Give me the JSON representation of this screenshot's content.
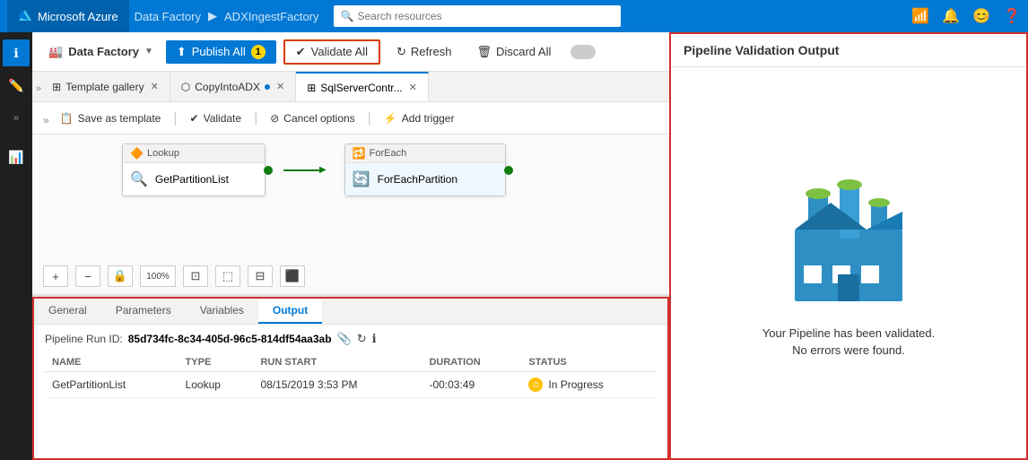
{
  "topbar": {
    "brand": "Microsoft Azure",
    "breadcrumb": [
      "Data Factory",
      "ADXIngestFactory"
    ],
    "search_placeholder": "Search resources",
    "icons": [
      "wifi-icon",
      "bell-icon",
      "face-icon",
      "question-icon"
    ]
  },
  "toolbar1": {
    "df_label": "Data Factory",
    "publish_label": "Publish All",
    "publish_badge": "1",
    "validate_all_label": "Validate All",
    "refresh_label": "Refresh",
    "discard_label": "Discard All"
  },
  "tabs": [
    {
      "label": "Template gallery",
      "icon": "template-icon",
      "closable": true,
      "active": false
    },
    {
      "label": "CopyIntoADX",
      "icon": "copy-icon",
      "closable": true,
      "active": false,
      "modified": true
    },
    {
      "label": "SqlServerContr...",
      "icon": "table-icon",
      "closable": true,
      "active": true
    }
  ],
  "toolbar2": {
    "save_template_label": "Save as template",
    "validate_label": "Validate",
    "cancel_options_label": "Cancel options",
    "add_trigger_label": "Add trigger"
  },
  "pipeline": {
    "node1": {
      "type": "Lookup",
      "label": "GetPartitionList"
    },
    "node2": {
      "type": "ForEach",
      "label": "ForEachPartition"
    }
  },
  "canvas_toolbar": {
    "add": "+",
    "remove": "−",
    "lock": "🔒",
    "zoom100": "100%",
    "zoom_fit": "⊞",
    "select": "⬚",
    "layout": "⊟",
    "settings": "⬛"
  },
  "bottom_panel": {
    "tabs": [
      "General",
      "Parameters",
      "Variables",
      "Output"
    ],
    "active_tab": "Output",
    "pipeline_run_label": "Pipeline Run ID:",
    "pipeline_run_id": "85d734fc-8c34-405d-96c5-814df54aa3ab",
    "table": {
      "headers": [
        "NAME",
        "TYPE",
        "RUN START",
        "DURATION",
        "STATUS"
      ],
      "rows": [
        {
          "name": "GetPartitionList",
          "type": "Lookup",
          "run_start": "08/15/2019 3:53 PM",
          "duration": "-00:03:49",
          "status": "In Progress"
        }
      ]
    }
  },
  "right_panel": {
    "title": "Pipeline Validation Output",
    "message_line1": "Your Pipeline has been validated.",
    "message_line2": "No errors were found."
  }
}
